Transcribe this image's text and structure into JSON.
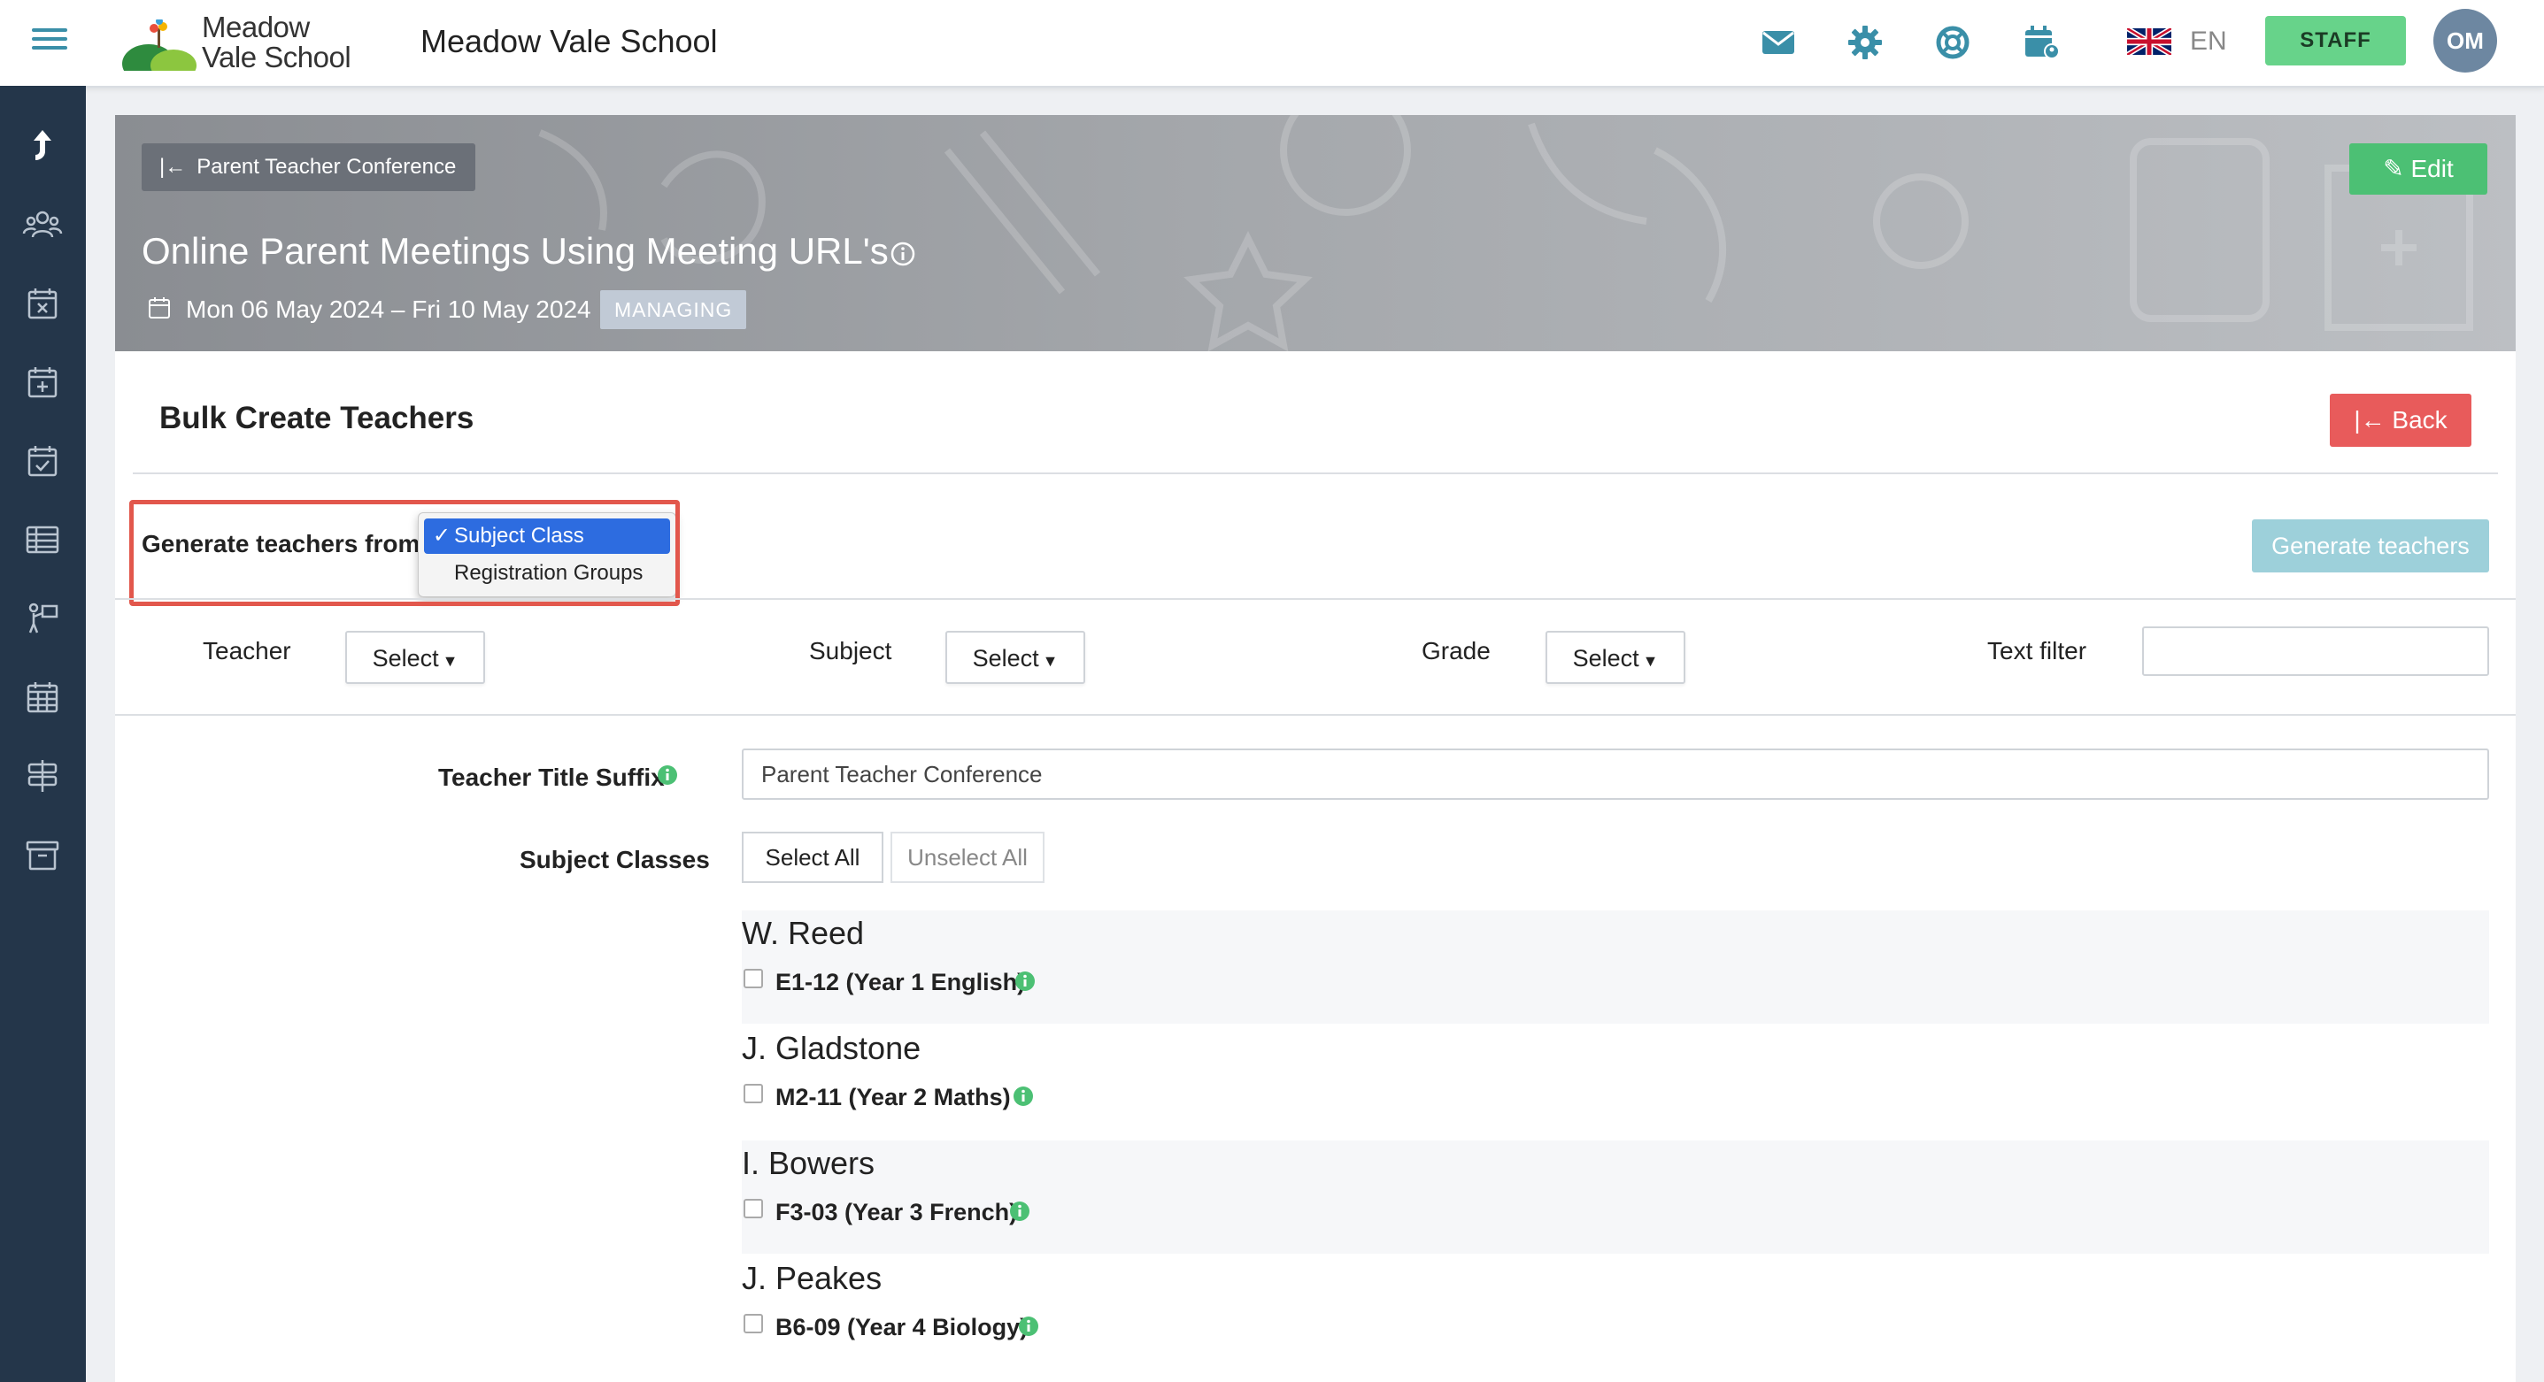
{
  "header": {
    "logo_line1": "Meadow",
    "logo_line2": "Vale School",
    "school_name": "Meadow Vale School",
    "icons": [
      "mail-icon",
      "gear-icon",
      "lifebuoy-icon",
      "calendar-user-icon"
    ],
    "language": "EN",
    "role_badge": "STAFF",
    "avatar_initials": "OM",
    "accent_color": "#3a8fa8"
  },
  "sidebar": {
    "icons": [
      "jump-icon",
      "users-icon",
      "calendar-x-icon",
      "calendar-plus-icon",
      "calendar-check-icon",
      "table-icon",
      "presenter-icon",
      "calendar-grid-icon",
      "signpost-icon",
      "archive-icon"
    ]
  },
  "banner": {
    "breadcrumb": "Parent Teacher Conference",
    "edit_label": "Edit",
    "title": "Online Parent Meetings Using Meeting URL's",
    "dates": "Mon 06 May 2024 – Fri 10 May 2024",
    "status_badge": "MANAGING"
  },
  "page": {
    "section_title": "Bulk Create Teachers",
    "back_label": "Back",
    "generate_from_label": "Generate teachers from:",
    "generate_from_options": [
      {
        "label": "Subject Class",
        "selected": true
      },
      {
        "label": "Registration Groups",
        "selected": false
      }
    ],
    "generate_button": "Generate teachers",
    "filters": {
      "teacher_label": "Teacher",
      "subject_label": "Subject",
      "grade_label": "Grade",
      "select_label": "Select",
      "text_filter_label": "Text filter",
      "text_filter_value": ""
    },
    "suffix_label": "Teacher Title Suffix",
    "suffix_value": "Parent Teacher Conference",
    "subject_classes_label": "Subject Classes",
    "select_all": "Select All",
    "unselect_all": "Unselect All",
    "groups": [
      {
        "teacher": "W. Reed",
        "class": "E1-12 (Year 1 English)",
        "checked": false
      },
      {
        "teacher": "J. Gladstone",
        "class": "M2-11 (Year 2 Maths)",
        "checked": false
      },
      {
        "teacher": "I. Bowers",
        "class": "F3-03 (Year 3 French)",
        "checked": false
      },
      {
        "teacher": "J. Peakes",
        "class": "B6-09 (Year 4 Biology)",
        "checked": false
      }
    ]
  },
  "colors": {
    "staff_green": "#67d38a",
    "edit_green": "#4cc074",
    "back_red": "#e85b5b",
    "highlight_red": "#e2574c",
    "generate_disabled": "#9dd0da",
    "sidebar_bg": "#24364a",
    "info_green": "#4cc074"
  }
}
